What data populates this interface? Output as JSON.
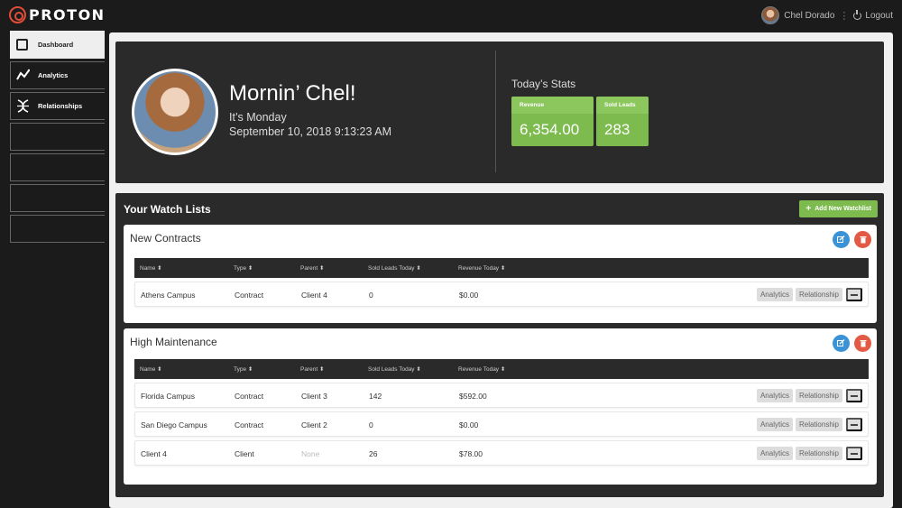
{
  "brand": {
    "name": "PROTON",
    "accent": "#e04e39"
  },
  "user": {
    "name": "Chel Dorado",
    "logout_label": "Logout"
  },
  "sidebar": {
    "items": [
      {
        "label": "Dashboard",
        "icon": "square-icon",
        "active": true
      },
      {
        "label": "Analytics",
        "icon": "line-chart-icon",
        "active": false
      },
      {
        "label": "Relationships",
        "icon": "dna-icon",
        "active": false
      },
      {
        "label": "",
        "icon": "",
        "active": false
      },
      {
        "label": "",
        "icon": "",
        "active": false
      },
      {
        "label": "",
        "icon": "",
        "active": false
      },
      {
        "label": "",
        "icon": "",
        "active": false
      }
    ]
  },
  "hero": {
    "greeting": "Mornin’ Chel!",
    "day": "It’s Monday",
    "datetime": "September 10, 2018 9:13:23 AM",
    "stats_title": "Today’s Stats",
    "stats": {
      "revenue_label": "Revenue",
      "revenue_value": "6,354.00",
      "leads_label": "Sold Leads",
      "leads_value": "283"
    },
    "stat_color": "#7dbb4f"
  },
  "watchlists": {
    "title": "Your Watch Lists",
    "add_label": "Add New Watchlist",
    "columns": [
      "Name ⬍",
      "Type ⬍",
      "Parent ⬍",
      "Sold Leads Today ⬍",
      "Revenue Today ⬍"
    ],
    "action_labels": {
      "analytics": "Analytics",
      "relationship": "Relationship"
    },
    "lists": [
      {
        "name": "New Contracts",
        "rows": [
          {
            "name": "Athens Campus",
            "type": "Contract",
            "parent": "Client 4",
            "leads": "0",
            "revenue": "$0.00"
          }
        ]
      },
      {
        "name": "High Maintenance",
        "rows": [
          {
            "name": "Florida Campus",
            "type": "Contract",
            "parent": "Client 3",
            "leads": "142",
            "revenue": "$592.00"
          },
          {
            "name": "San Diego Campus",
            "type": "Contract",
            "parent": "Client 2",
            "leads": "0",
            "revenue": "$0.00"
          },
          {
            "name": "Client 4",
            "type": "Client",
            "parent": "None",
            "leads": "26",
            "revenue": "$78.00"
          }
        ]
      }
    ]
  }
}
